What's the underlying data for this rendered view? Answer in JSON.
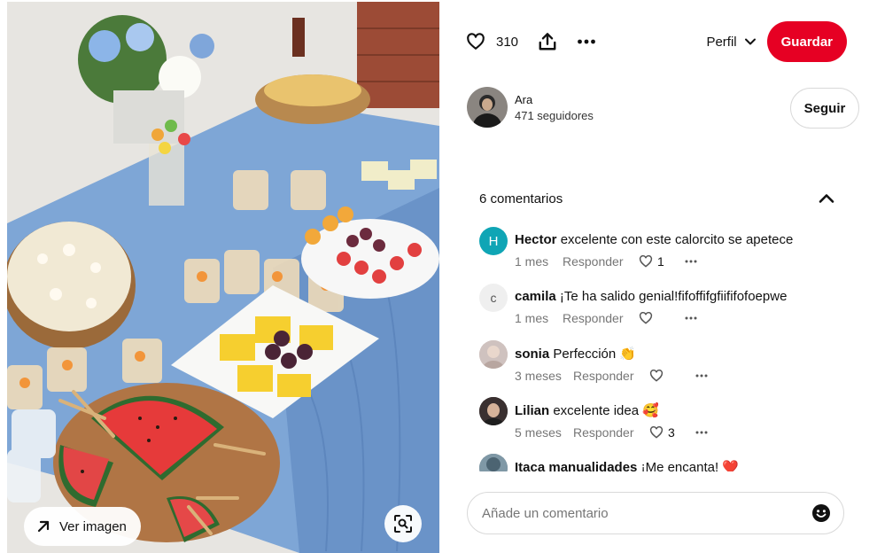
{
  "image_panel": {
    "view_image_label": "Ver imagen",
    "icons": {
      "view": "arrow-up-right-icon",
      "lens": "visual-search-icon"
    }
  },
  "toolbar": {
    "like_count": "310",
    "profile_label": "Perfil",
    "save_label": "Guardar",
    "icons": {
      "like": "heart-icon",
      "share": "share-icon",
      "more": "more-icon",
      "profile": "chevron-down-icon"
    },
    "accent_color": "#e60023"
  },
  "author": {
    "name": "Ara",
    "followers": "471 seguidores",
    "follow_label": "Seguir"
  },
  "comments": {
    "title": "6 comentarios",
    "items": [
      {
        "user": "Hector",
        "text": "excelente con este calorcito se apetece",
        "time": "1 mes",
        "reply": "Responder",
        "likes": "1",
        "avatar_initial": "H",
        "avatar_color": "#0fa5b5"
      },
      {
        "user": "camila",
        "text": "¡Te ha salido genial!fifoffifgfiififofoepwe",
        "time": "1 mes",
        "reply": "Responder",
        "likes": "",
        "avatar_initial": "c",
        "avatar_color": "#efefef"
      },
      {
        "user": "sonia",
        "text": "Perfección 👏",
        "time": "3 meses",
        "reply": "Responder",
        "likes": ""
      },
      {
        "user": "Lilian",
        "text": "excelente idea 🥰",
        "time": "5 meses",
        "reply": "Responder",
        "likes": "3"
      },
      {
        "user": "Itaca manualidades",
        "text": "¡Me encanta! ❤️",
        "time": "",
        "reply": "",
        "likes": ""
      }
    ]
  },
  "add_comment": {
    "placeholder": "Añade un comentario",
    "icons": {
      "emoji": "emoji-icon"
    }
  }
}
